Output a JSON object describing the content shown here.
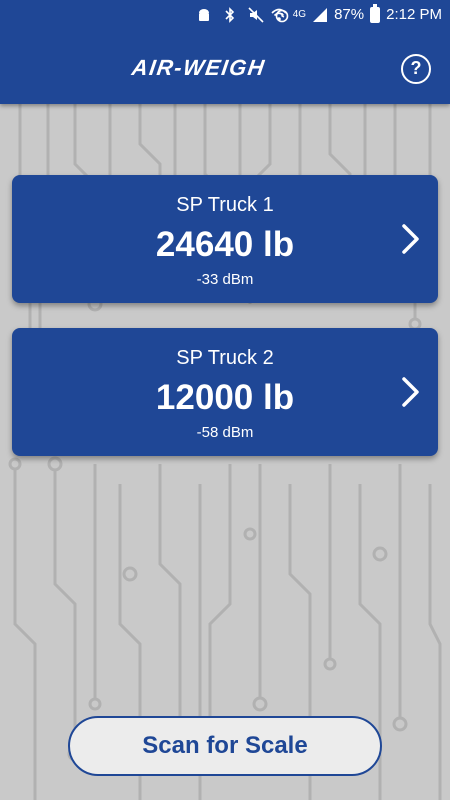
{
  "status_bar": {
    "battery_percent": "87%",
    "time": "2:12 PM",
    "network": "4G",
    "icons": [
      "android-icon",
      "bluetooth-icon",
      "mute-icon",
      "alarm-icon",
      "wifi-icon",
      "signal-icon",
      "battery-icon"
    ]
  },
  "header": {
    "logo_text": "AIR-WEIGH",
    "help_label": "?"
  },
  "scales": [
    {
      "name": "SP Truck 1",
      "weight": "24640 lb",
      "signal": "-33 dBm"
    },
    {
      "name": "SP Truck 2",
      "weight": "12000 lb",
      "signal": "-58 dBm"
    }
  ],
  "actions": {
    "scan_label": "Scan for Scale"
  },
  "colors": {
    "brand_blue": "#1f4796",
    "background_gray": "#c9c9c9",
    "button_fill": "#ececec"
  }
}
